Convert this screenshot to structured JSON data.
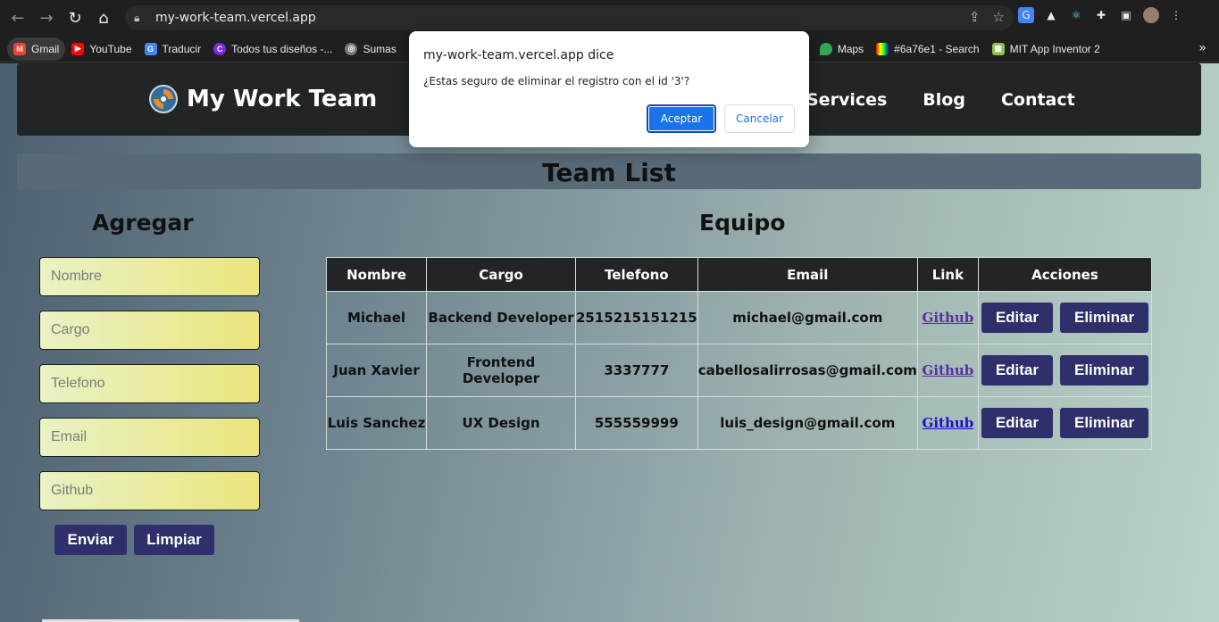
{
  "browser": {
    "url": "my-work-team.vercel.app",
    "bookmarks": [
      {
        "label": "Gmail",
        "icon": "gmail-icon",
        "color": "#ea4335"
      },
      {
        "label": "YouTube",
        "icon": "youtube-icon",
        "color": "#ff0000"
      },
      {
        "label": "Traducir",
        "icon": "translate-icon",
        "color": "#4285f4"
      },
      {
        "label": "Todos tus diseños -...",
        "icon": "canva-icon",
        "color": "#7d2ae8"
      },
      {
        "label": "Sumas",
        "icon": "globe-icon",
        "color": "#777777"
      },
      {
        "label": "Maps",
        "icon": "maps-icon",
        "color": "#34a853"
      },
      {
        "label": "#6a76e1 - Search",
        "icon": "color-search-icon",
        "color": "#6a76e1"
      },
      {
        "label": "MIT App Inventor 2",
        "icon": "appinventor-icon",
        "color": "#8bc34a"
      }
    ]
  },
  "site": {
    "brand": "My Work Team",
    "nav": [
      "Services",
      "Blog",
      "Contact"
    ],
    "team_list_title": "Team List",
    "form_title": "Agregar",
    "table_title": "Equipo",
    "form": {
      "placeholders": [
        "Nombre",
        "Cargo",
        "Telefono",
        "Email",
        "Github"
      ],
      "submit": "Enviar",
      "clear": "Limpiar"
    },
    "table": {
      "headers": [
        "Nombre",
        "Cargo",
        "Telefono",
        "Email",
        "Link",
        "Acciones"
      ],
      "rows": [
        {
          "nombre": "Michael",
          "cargo": "Backend Developer",
          "telefono": "2515215151215",
          "email": "michael@gmail.com",
          "link": "Github"
        },
        {
          "nombre": "Juan Xavier",
          "cargo": "Frontend Developer",
          "telefono": "3337777",
          "email": "cabellosalirrosas@gmail.com",
          "link": "Github"
        },
        {
          "nombre": "Luis Sanchez",
          "cargo": "UX Design",
          "telefono": "555559999",
          "email": "luis_design@gmail.com",
          "link": "Github"
        }
      ],
      "edit_label": "Editar",
      "delete_label": "Eliminar"
    }
  },
  "dialog": {
    "title": "my-work-team.vercel.app dice",
    "message": "¿Estas seguro de eliminar el registro con el id '3'?",
    "ok": "Aceptar",
    "cancel": "Cancelar"
  },
  "colors": {
    "button": "#2e2f6b",
    "nav_bg": "#222526",
    "dialog_primary": "#1a73e8"
  }
}
